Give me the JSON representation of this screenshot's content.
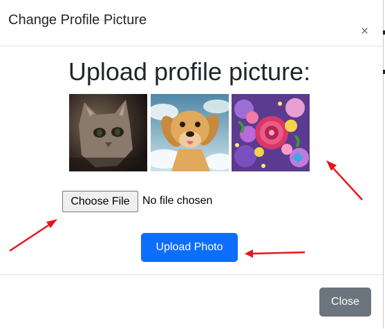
{
  "modal": {
    "title": "Change Profile Picture",
    "close_glyph": "×",
    "heading": "Upload profile picture:",
    "thumbnails": [
      {
        "name": "cat-photo",
        "alt": "cat"
      },
      {
        "name": "puppy-photo",
        "alt": "dog"
      },
      {
        "name": "flowers-photo",
        "alt": "flowers"
      }
    ],
    "file_input": {
      "button_label": "Choose File",
      "status": "No file chosen"
    },
    "upload_button": "Upload Photo",
    "footer_close_button": "Close"
  },
  "colors": {
    "primary": "#0d6efd",
    "secondary": "#6c757d",
    "annotation_arrow": "#e8141a"
  },
  "annotations": {
    "arrow_count": 3,
    "icon": "red-arrow"
  }
}
